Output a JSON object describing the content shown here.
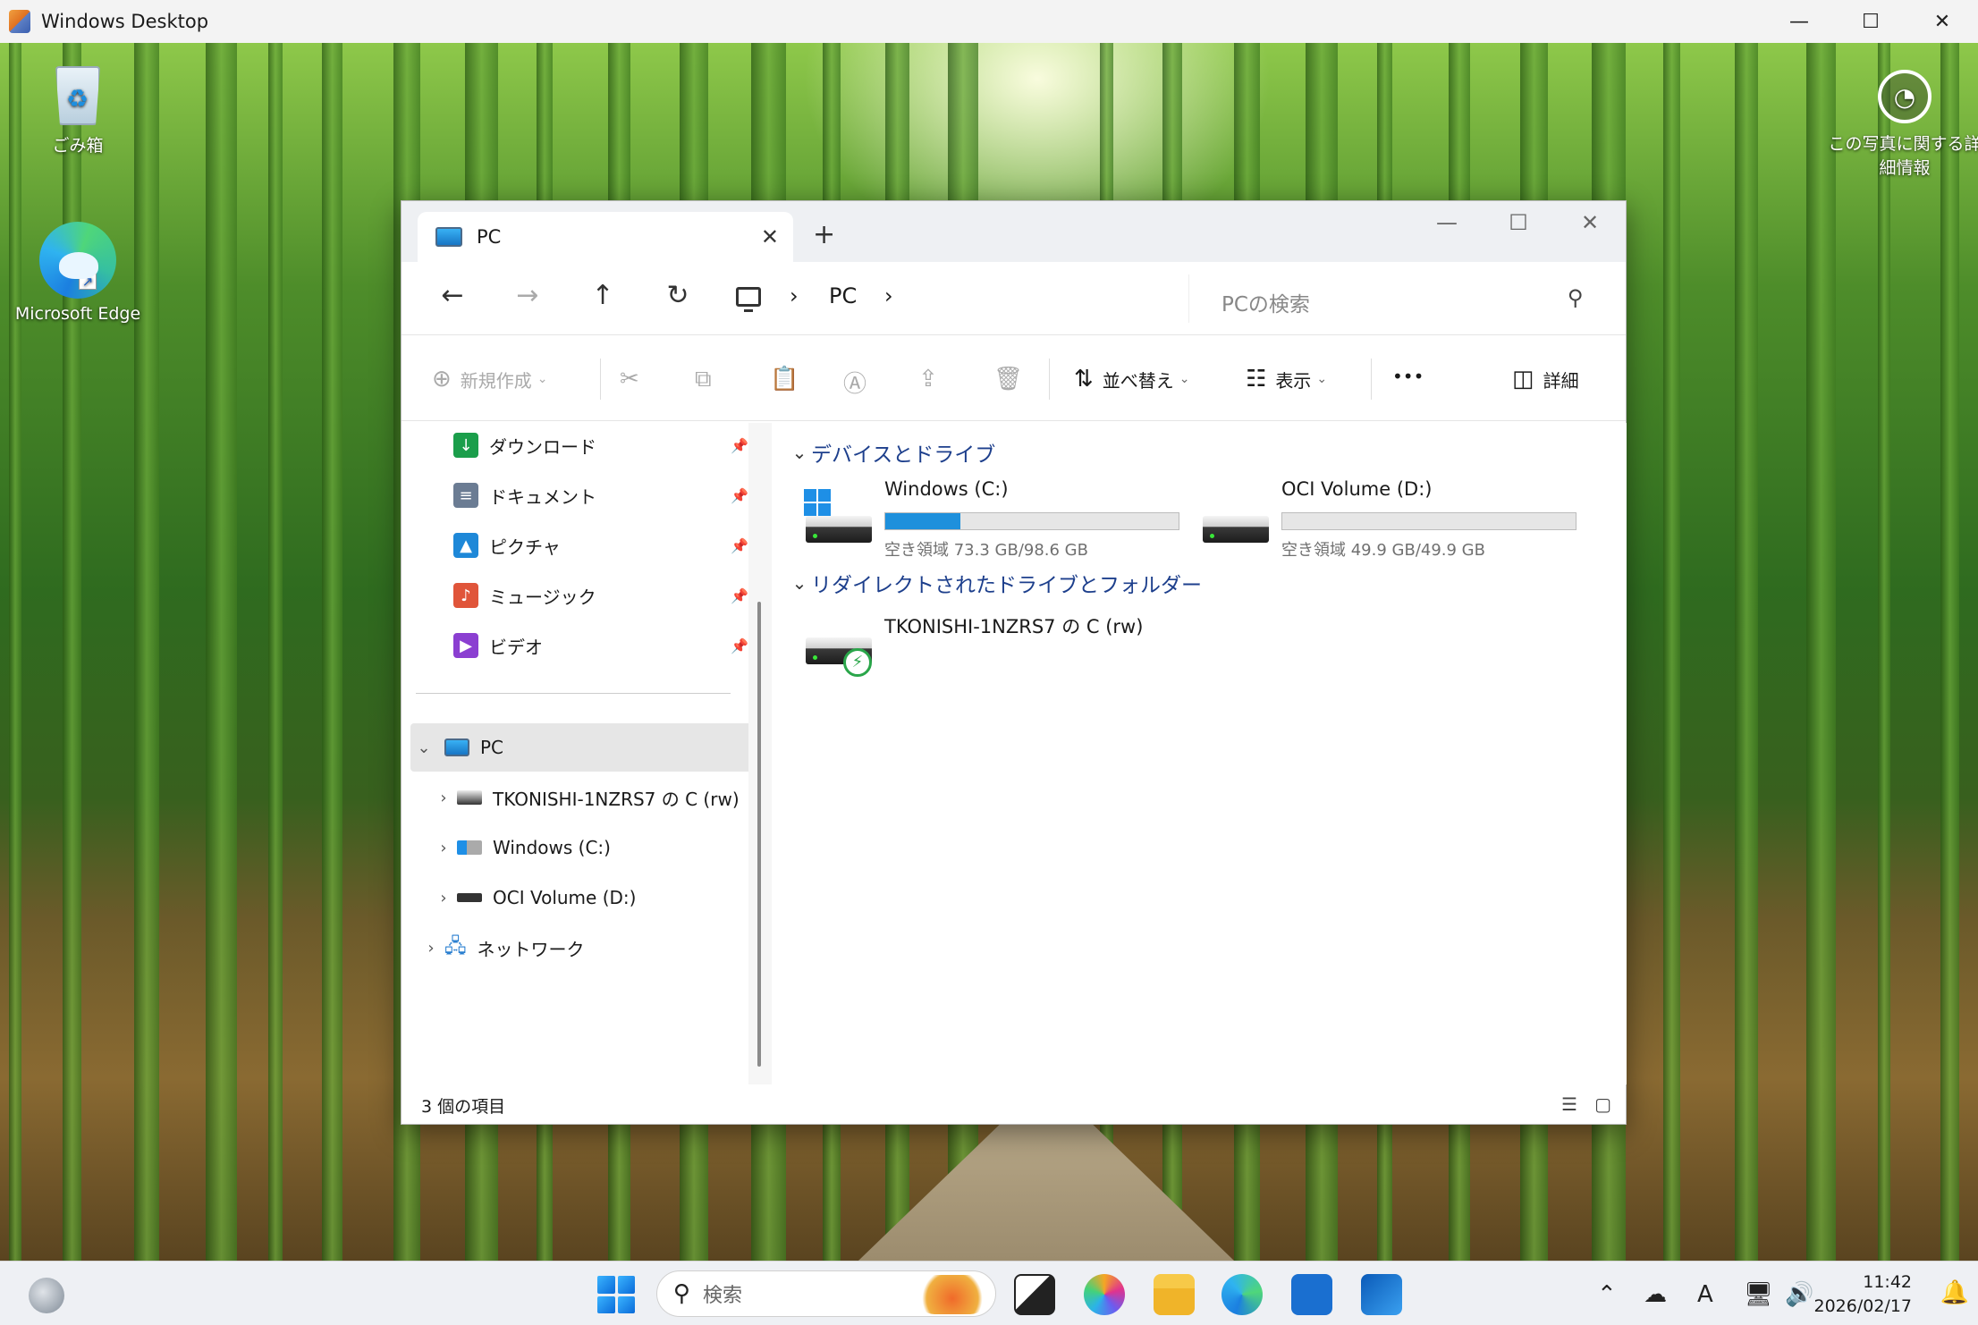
{
  "rdp": {
    "title": "Windows Desktop",
    "minimize": "—",
    "maximize": "☐",
    "close": "✕"
  },
  "desktop": {
    "recycle_bin": "ごみ箱",
    "edge": "Microsoft Edge",
    "photo_info_line1": "この写真に関する詳",
    "photo_info_line2": "細情報"
  },
  "explorer": {
    "tab_title": "PC",
    "tab_close": "✕",
    "new_tab": "+",
    "address": {
      "crumb": "PC",
      "sep": "›"
    },
    "search_placeholder": "PCの検索",
    "commands": {
      "new": "新規作成",
      "sort": "並べ替え",
      "view": "表示",
      "more": "•••",
      "details": "詳細"
    },
    "quick_access": [
      {
        "label": "ダウンロード",
        "icon": "download-icon",
        "color": "#1b9e4b"
      },
      {
        "label": "ドキュメント",
        "icon": "document-icon",
        "color": "#6b7c93"
      },
      {
        "label": "ピクチャ",
        "icon": "picture-icon",
        "color": "#1e88d8"
      },
      {
        "label": "ミュージック",
        "icon": "music-icon",
        "color": "#e0553a"
      },
      {
        "label": "ビデオ",
        "icon": "video-icon",
        "color": "#8b3fd1"
      }
    ],
    "tree": {
      "pc": "PC",
      "items": [
        {
          "label": "TKONISHI-1NZRS7 の C (rw)"
        },
        {
          "label": "Windows (C:)"
        },
        {
          "label": "OCI Volume (D:)"
        }
      ],
      "network": "ネットワーク"
    },
    "groups": {
      "devices": "デバイスとドライブ",
      "redirected": "リダイレクトされたドライブとフォルダー"
    },
    "drives": [
      {
        "name": "Windows (C:)",
        "free": "空き領域 73.3 GB/98.6 GB",
        "used_fraction": 0.257
      },
      {
        "name": "OCI Volume (D:)",
        "free": "空き領域 49.9 GB/49.9 GB",
        "used_fraction": 0.0
      }
    ],
    "redirected_drive": {
      "name": "TKONISHI-1NZRS7 の C (rw)"
    },
    "status": "3 個の項目"
  },
  "taskbar": {
    "search_placeholder": "検索",
    "time": "11:42",
    "date": "2026/02/17",
    "ime": "A"
  }
}
